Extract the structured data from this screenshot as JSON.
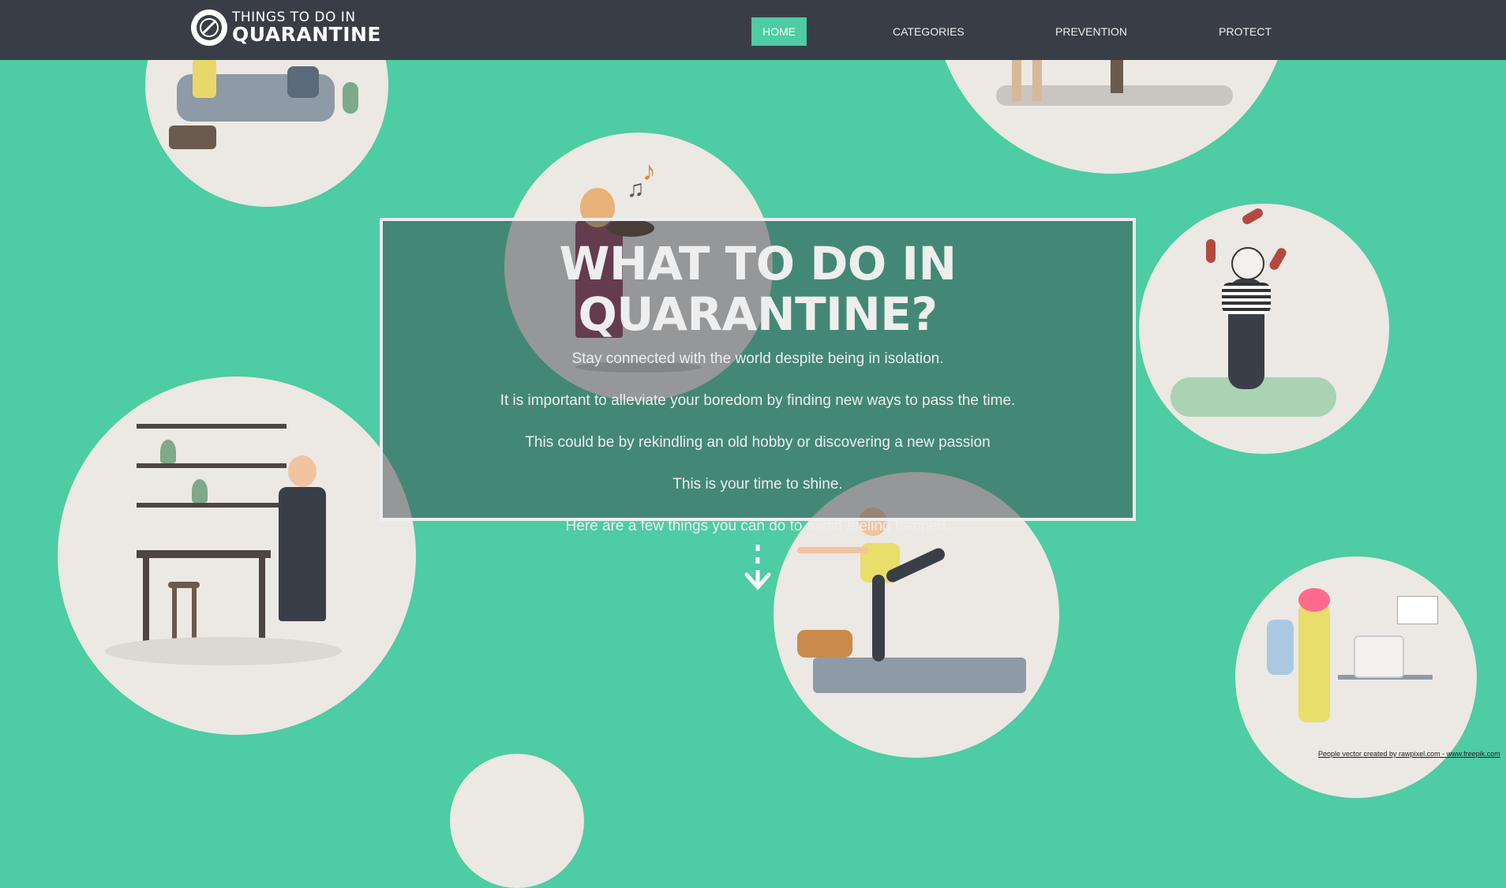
{
  "header": {
    "logo_line1": "THINGS TO DO IN",
    "logo_line2": "QUARANTINE",
    "nav": [
      {
        "label": "HOME",
        "active": true
      },
      {
        "label": "CATEGORIES",
        "active": false
      },
      {
        "label": "PREVENTION",
        "active": false
      },
      {
        "label": "PROTECT",
        "active": false
      }
    ]
  },
  "hero": {
    "title": "WHAT TO DO IN QUARANTINE?",
    "lines": [
      "Stay connected with the world despite being in isolation.",
      "It is important to alleviate your boredom by finding new ways to pass the time.",
      "This could be by rekindling an old hobby or discovering a new passion",
      "This is your time to shine.",
      "Here are a few things you can do to avoid feeling trapped."
    ]
  },
  "credit": "People vector created by rawpixel.com - www.freepik.com",
  "colors": {
    "background": "#4ecca3",
    "header": "#393e46",
    "circle": "#ece8e4",
    "text": "#eeeeee"
  },
  "icons": [
    "coronavirus-logo-icon",
    "scroll-down-arrow-icon"
  ]
}
